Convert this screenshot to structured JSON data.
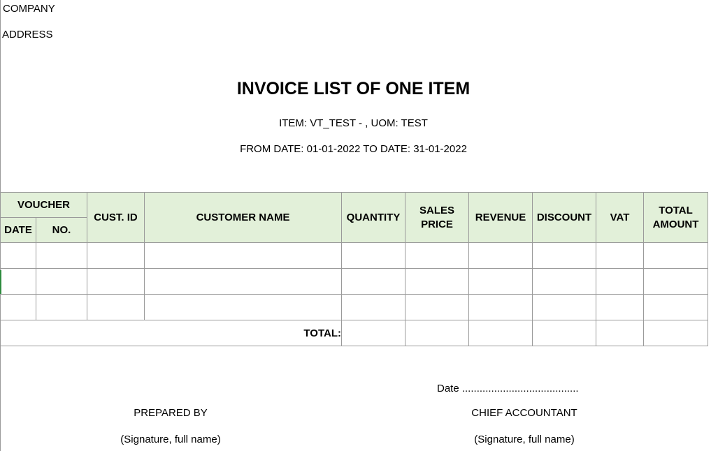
{
  "header": {
    "company": "COMPANY",
    "address": "ADDRESS",
    "title": "INVOICE LIST OF ONE ITEM",
    "item_line": "ITEM: VT_TEST - , UOM: TEST",
    "date_range": "FROM DATE: 01-01-2022 TO DATE: 31-01-2022"
  },
  "table": {
    "voucher": "VOUCHER",
    "date": "DATE",
    "no": "NO.",
    "cust_id": "CUST. ID",
    "customer_name": "CUSTOMER NAME",
    "quantity": "QUANTITY",
    "sales_price": "SALES PRICE",
    "revenue": "REVENUE",
    "discount": "DISCOUNT",
    "vat": "VAT",
    "total_amount": "TOTAL AMOUNT",
    "total_label": "TOTAL:"
  },
  "footer": {
    "date_line": "Date ........................................",
    "prepared_by": "PREPARED BY",
    "chief_accountant": "CHIEF ACCOUNTANT",
    "signature_left": "(Signature, full name)",
    "signature_right": "(Signature, full name)"
  }
}
